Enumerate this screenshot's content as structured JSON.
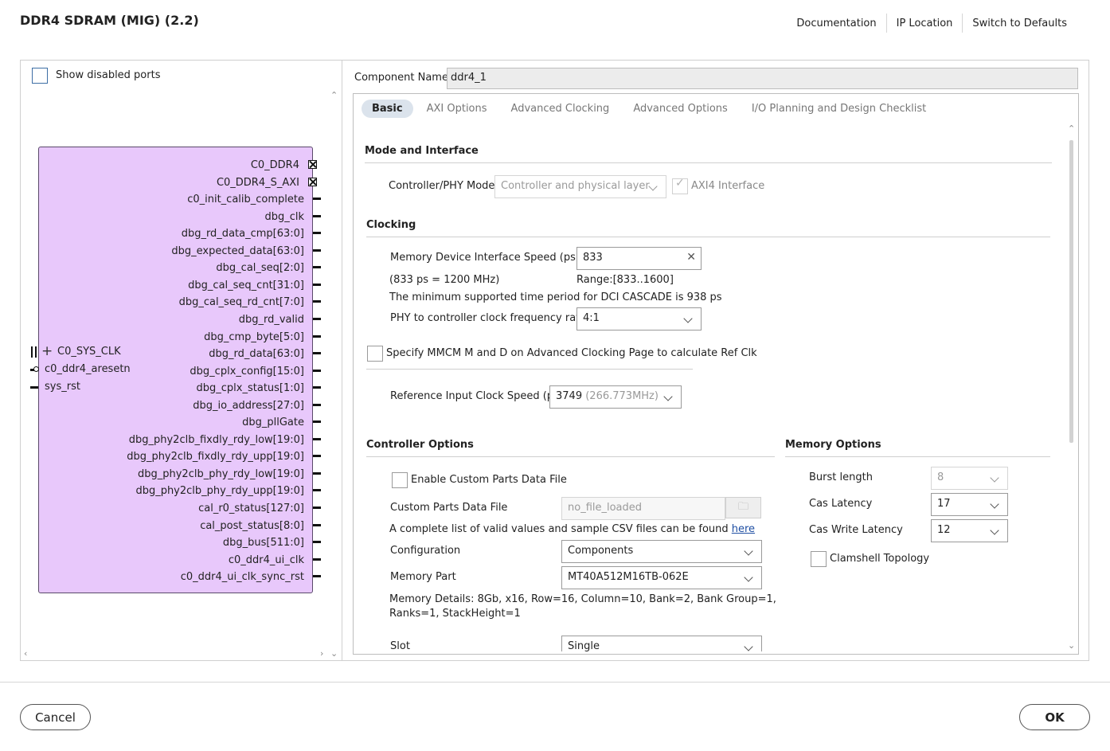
{
  "window": {
    "title": "DDR4 SDRAM (MIG) (2.2)",
    "links": [
      "Documentation",
      "IP Location",
      "Switch to Defaults"
    ]
  },
  "left_panel": {
    "show_disabled_label": "Show disabled ports",
    "symbol": {
      "right_ports": [
        "C0_DDR4",
        "C0_DDR4_S_AXI",
        "c0_init_calib_complete",
        "dbg_clk",
        "dbg_rd_data_cmp[63:0]",
        "dbg_expected_data[63:0]",
        "dbg_cal_seq[2:0]",
        "dbg_cal_seq_cnt[31:0]",
        "dbg_cal_seq_rd_cnt[7:0]",
        "dbg_rd_valid",
        "dbg_cmp_byte[5:0]",
        "dbg_rd_data[63:0]",
        "dbg_cplx_config[15:0]",
        "dbg_cplx_status[1:0]",
        "dbg_io_address[27:0]",
        "dbg_pllGate",
        "dbg_phy2clb_fixdly_rdy_low[19:0]",
        "dbg_phy2clb_fixdly_rdy_upp[19:0]",
        "dbg_phy2clb_phy_rdy_low[19:0]",
        "dbg_phy2clb_phy_rdy_upp[19:0]",
        "cal_r0_status[127:0]",
        "cal_post_status[8:0]",
        "dbg_bus[511:0]",
        "c0_ddr4_ui_clk",
        "c0_ddr4_ui_clk_sync_rst"
      ],
      "left_ports": [
        "C0_SYS_CLK",
        "c0_ddr4_aresetn",
        "sys_rst"
      ],
      "fill_color": "#e8c8fb"
    }
  },
  "component": {
    "label": "Component Name",
    "value": "ddr4_1"
  },
  "tabs": [
    "Basic",
    "AXI Options",
    "Advanced Clocking",
    "Advanced Options",
    "I/O Planning and Design Checklist"
  ],
  "basic": {
    "mode_section": "Mode and Interface",
    "controller_phy_label": "Controller/PHY Mode",
    "controller_phy_value": "Controller and physical layer",
    "axi4_label": "AXI4 Interface",
    "clocking_section": "Clocking",
    "mem_speed_label": "Memory Device Interface Speed (ps)",
    "mem_speed_value": "833",
    "mem_speed_note": "(833 ps = 1200 MHz)",
    "mem_speed_range": "Range:[833..1600]",
    "dci_note": "The minimum supported time period for DCI CASCADE is 938 ps",
    "phy_ratio_label": "PHY to controller clock frequency ratio",
    "phy_ratio_value": "4:1",
    "mmcm_label": "Specify MMCM M and D on Advanced Clocking Page to calculate Ref Clk",
    "ref_clk_label": "Reference Input Clock Speed (ps)",
    "ref_clk_value": "3749",
    "ref_clk_mhz": "(266.773MHz)",
    "controller_section": "Controller Options",
    "custom_parts_chk": "Enable Custom Parts Data File",
    "custom_parts_label": "Custom Parts Data File",
    "custom_parts_value": "no_file_loaded",
    "csv_note": "A complete list of valid values and sample CSV files can be found",
    "csv_link": "here",
    "config_label": "Configuration",
    "config_value": "Components",
    "mem_part_label": "Memory Part",
    "mem_part_value": "MT40A512M16TB-062E",
    "mem_details_1": "Memory Details: 8Gb, x16, Row=16, Column=10, Bank=2, Bank Group=1,",
    "mem_details_2": "Ranks=1, StackHeight=1",
    "slot_label": "Slot",
    "slot_value": "Single",
    "memory_section": "Memory Options",
    "burst_label": "Burst length",
    "burst_value": "8",
    "cas_label": "Cas Latency",
    "cas_value": "17",
    "cas_write_label": "Cas Write Latency",
    "cas_write_value": "12",
    "clamshell_label": "Clamshell Topology"
  },
  "footer": {
    "cancel": "Cancel",
    "ok": "OK"
  }
}
